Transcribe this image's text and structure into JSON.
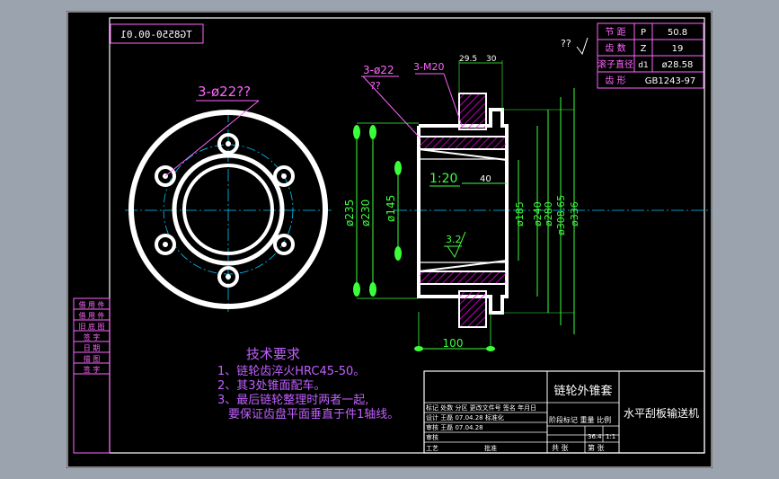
{
  "colors": {
    "background": "#9ba3ae",
    "sheet": "#000000",
    "frame": "#ffffff",
    "centerline": "#00c8ff",
    "dimension": "#3cff3c",
    "leader": "#ff66ff",
    "hatch": "#ff00ff",
    "note": "#c060ff"
  },
  "drawing_number": "TG8550-00.01",
  "roughness_note": "??",
  "views": {
    "front": {
      "hole_callout": "3-ø22??"
    },
    "section": {
      "label_holes": "3-ø22",
      "label_holes_q": "??",
      "label_thread": "3-M20",
      "dim_29_5": "29.5",
      "dim_30": "30",
      "dim_235": "ø235",
      "dim_230": "ø230",
      "dim_145": "ø145",
      "dim_185": "ø185",
      "dim_240": "ø240",
      "dim_280": "ø280",
      "dim_308_65": "ø308.65",
      "dim_336": "ø336",
      "taper": "1:20",
      "dim_40": "40",
      "roughness": "3.2",
      "dim_100": "100"
    }
  },
  "params_table": {
    "rows": [
      {
        "label": "节 距",
        "sym": "P",
        "value": "50.8"
      },
      {
        "label": "齿 数",
        "sym": "Z",
        "value": "19"
      },
      {
        "label": "滚子直径",
        "sym": "d1",
        "value": "ø28.58"
      },
      {
        "label": "齿 形",
        "sym": "",
        "value": "GB1243-97"
      }
    ]
  },
  "tech_req": {
    "title": "技术要求",
    "lines": [
      "1、链轮齿淬火HRC45-50。",
      "2、其3处锥面配车。",
      "3、最后链轮整理时两者一起,",
      "要保证齿盘平面垂直于件1轴线。"
    ]
  },
  "title_block": {
    "part_name": "链轮外锥套",
    "assembly": "水平刮板输送机",
    "header_row": "标记 处数 分区 更改文件号 签名 年月日",
    "row_design": "设计 王磊 07.04.28 标准化",
    "row_check": "审核 王磊 07.04.28",
    "row_craft": "审核",
    "row_process": "工艺",
    "row_approve": "批准",
    "stage_header": "阶段标记 重量 比例",
    "weight": "36.4",
    "scale": "1:1",
    "sheets_total": "共 张",
    "sheet_no": "第 张"
  },
  "left_stamps": [
    "借 用 件",
    "借 用 件",
    "旧 底 图",
    "签 字",
    "日 期",
    "描 图",
    "签 字"
  ]
}
